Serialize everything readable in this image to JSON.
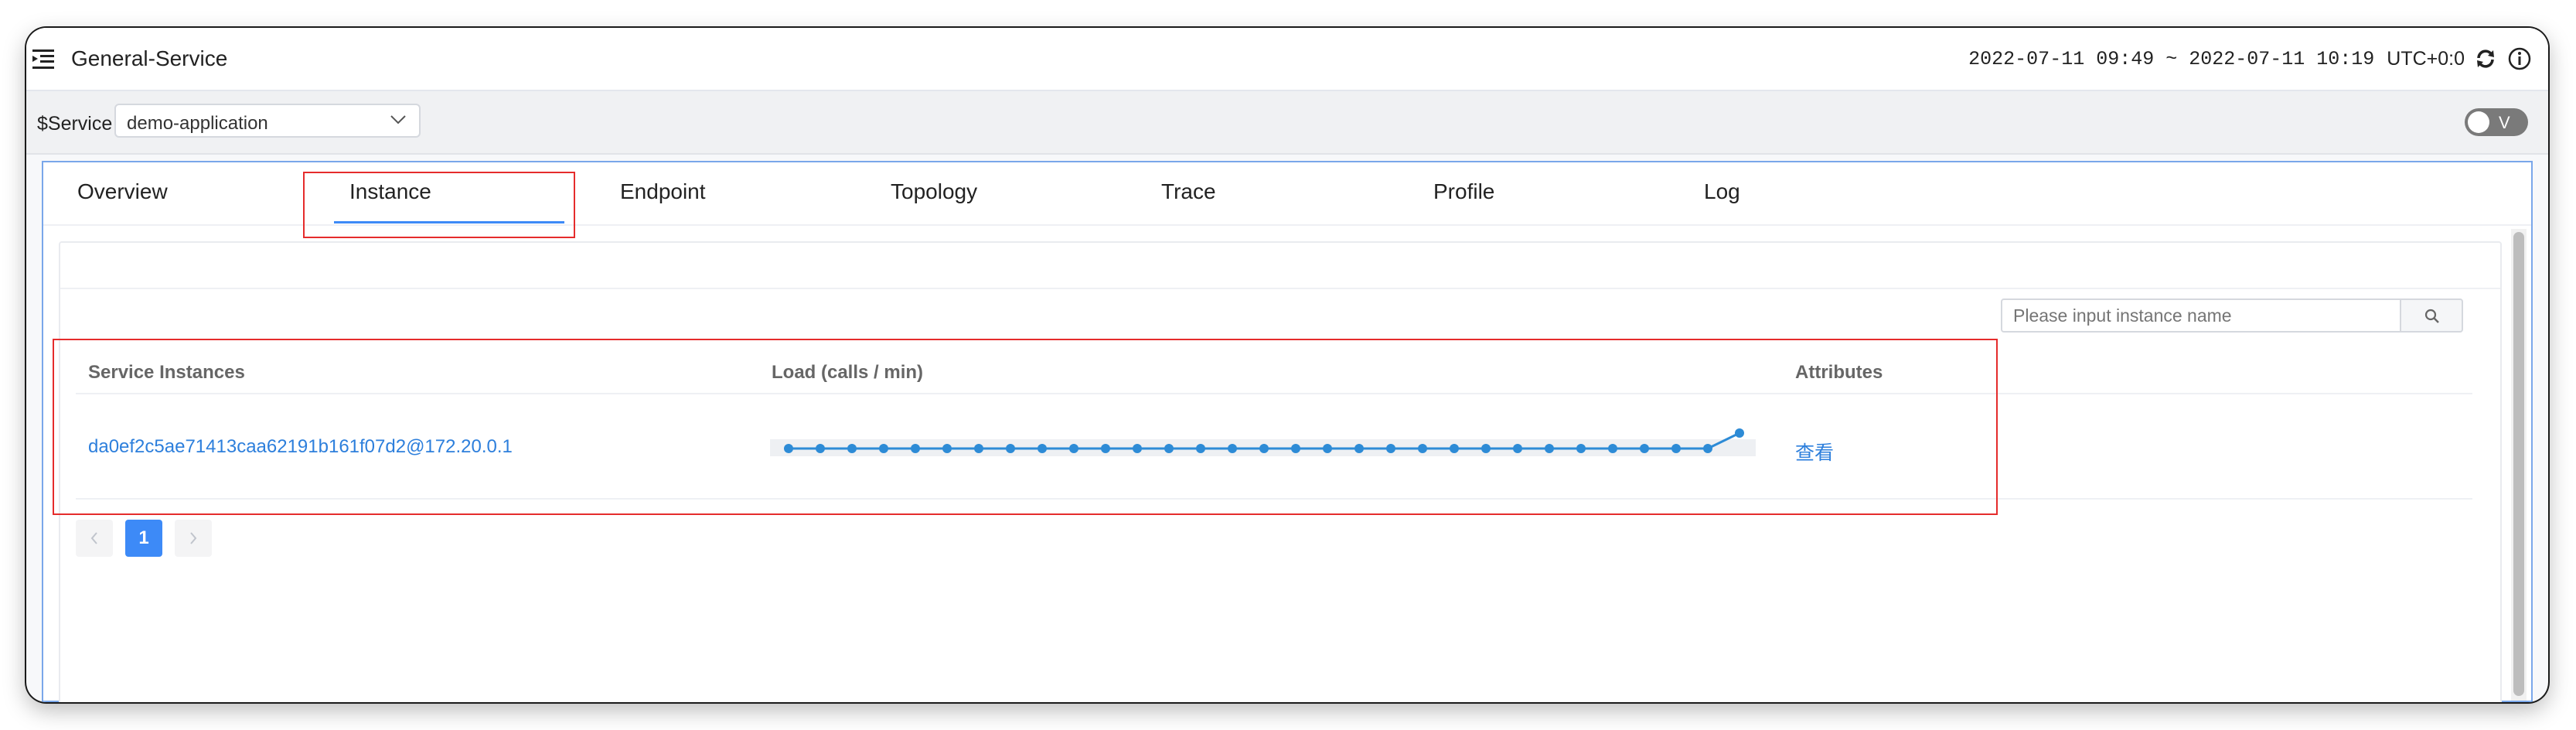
{
  "nav": {
    "title": "General-Service",
    "time_range": "2022-07-11 09:49 ~ 2022-07-11 10:19",
    "timezone": "UTC+0:0",
    "icons": [
      "menu-fold-icon",
      "refresh-icon",
      "info-icon"
    ]
  },
  "toolbar": {
    "service_label": "$Service",
    "service_value": "demo-application",
    "toggle_label": "V"
  },
  "tabs": [
    {
      "label": "Overview"
    },
    {
      "label": "Instance",
      "active": true
    },
    {
      "label": "Endpoint"
    },
    {
      "label": "Topology"
    },
    {
      "label": "Trace"
    },
    {
      "label": "Profile"
    },
    {
      "label": "Log"
    }
  ],
  "search": {
    "placeholder": "Please input instance name"
  },
  "table": {
    "headers": [
      "Service Instances",
      "Load (calls / min)",
      "Attributes"
    ],
    "rows": [
      {
        "instance": "da0ef2c5ae71413caa62191b161f07d2@172.20.0.1",
        "load": [
          0,
          0,
          0,
          0,
          0,
          0,
          0,
          0,
          0,
          0,
          0,
          0,
          0,
          0,
          0,
          0,
          0,
          0,
          0,
          0,
          0,
          0,
          0,
          0,
          0,
          0,
          0,
          0,
          0,
          0,
          1
        ],
        "attributes_link": "查看"
      }
    ]
  },
  "pagination": {
    "current": "1"
  },
  "colors": {
    "accent": "#3d8af7",
    "link": "#2d7fdc",
    "highlight_box": "#e52c2c"
  }
}
